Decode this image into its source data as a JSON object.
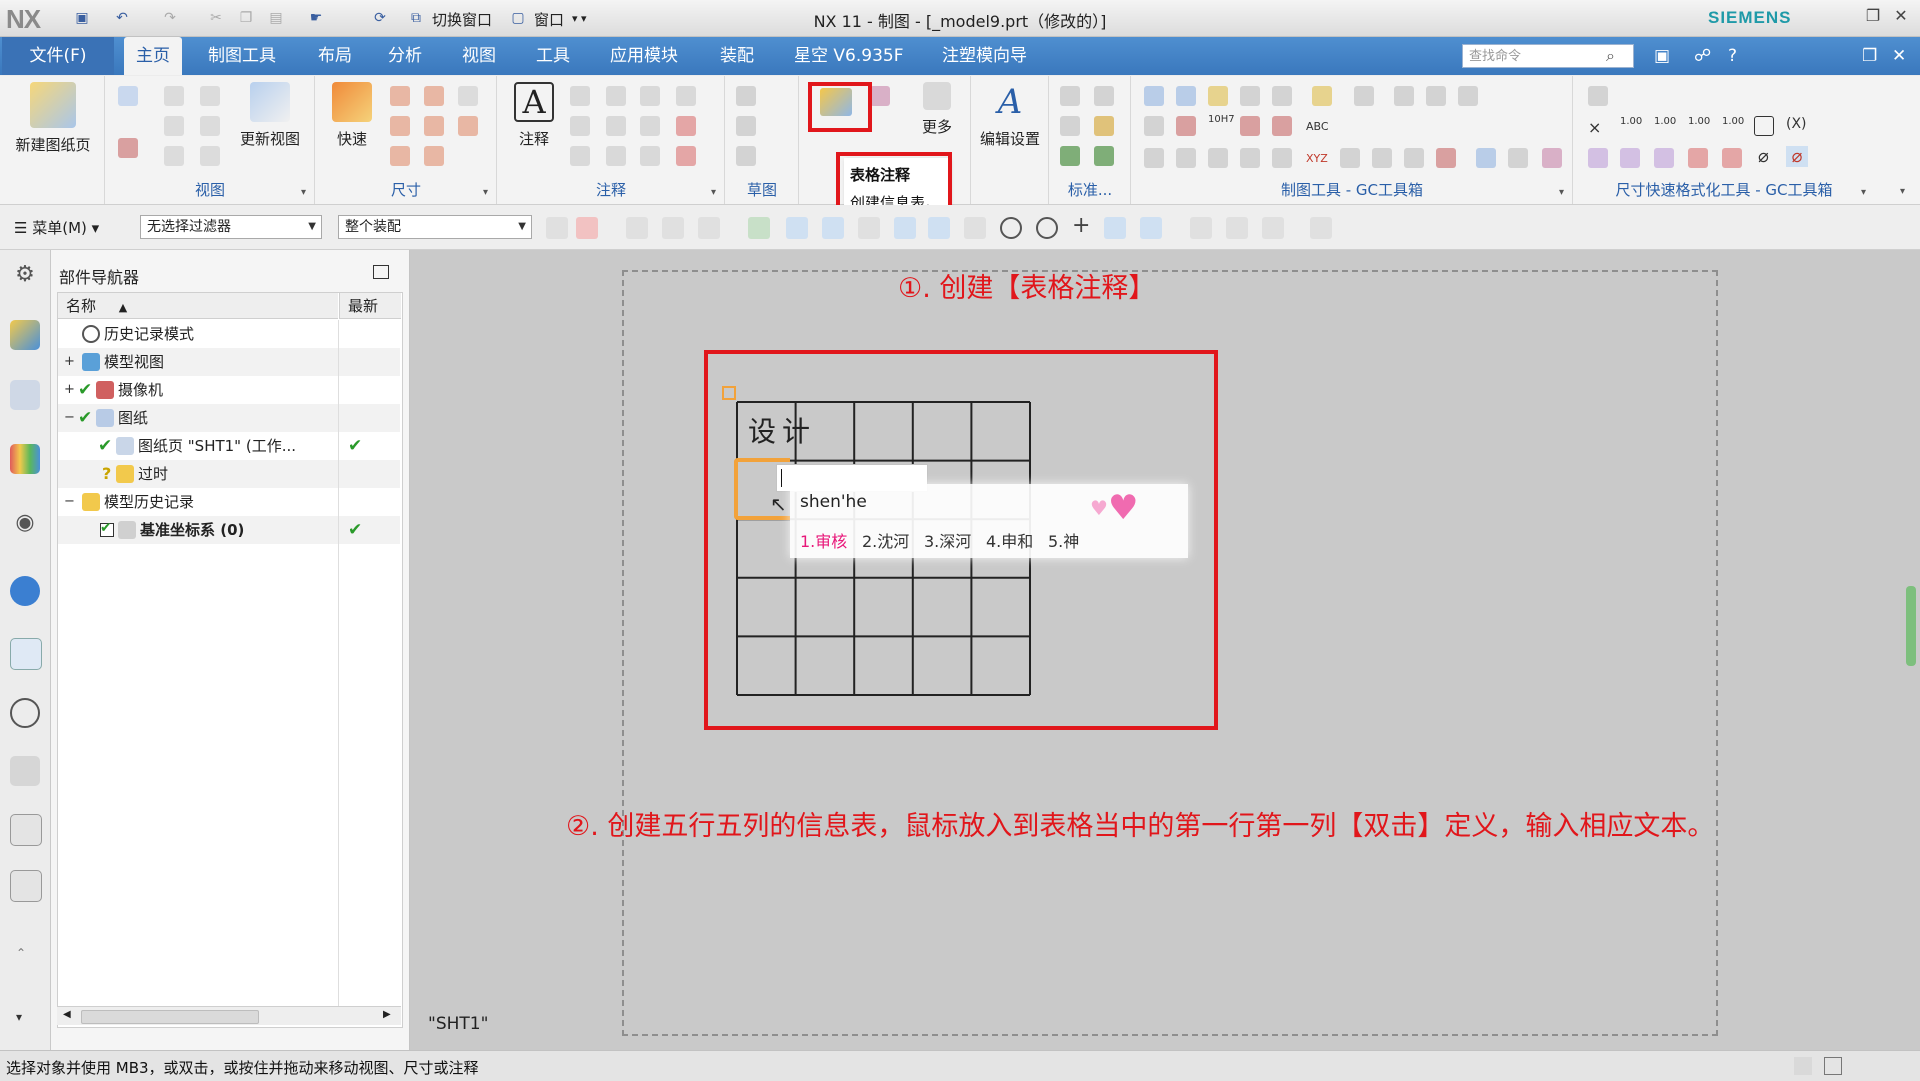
{
  "app": {
    "logo": "NX",
    "window_title": "NX 11 - 制图 - [_model9.prt（修改的）]",
    "brand": "SIEMENS",
    "quick_access": {
      "switch_window": "切换窗口",
      "window_menu": "窗口"
    }
  },
  "tabs": [
    {
      "label": "文件(F)"
    },
    {
      "label": "主页"
    },
    {
      "label": "制图工具"
    },
    {
      "label": "布局"
    },
    {
      "label": "分析"
    },
    {
      "label": "视图"
    },
    {
      "label": "工具"
    },
    {
      "label": "应用模块"
    },
    {
      "label": "装配"
    },
    {
      "label": "星空 V6.935F"
    },
    {
      "label": "注塑模向导"
    }
  ],
  "search": {
    "placeholder": "查找命令"
  },
  "ribbon": {
    "new_sheet": "新建图纸页",
    "update_view": "更新视图",
    "quick": "快速",
    "note": "注释",
    "more": "更多",
    "edit_settings": "编辑设置",
    "groups": {
      "view": "视图",
      "dimension": "尺寸",
      "annotation": "注释",
      "sketch": "草图",
      "standard": "标准...",
      "gc_toolbox": "制图工具 - GC工具箱",
      "dim_format": "尺寸快速格式化工具 - GC工具箱"
    },
    "small_labels": {
      "v1": "1.00",
      "v2": "1.00",
      "v3": "1.00",
      "v4": "1.00",
      "abc": "ABC",
      "xyz": "XYZ",
      "h7": "10H7"
    }
  },
  "popup_menu": {
    "items": [
      "表格注释",
      "创建信息表。"
    ]
  },
  "toolbar2": {
    "menu": "菜单(M)",
    "filter": "无选择过滤器",
    "scope": "整个装配"
  },
  "navigator": {
    "title": "部件导航器",
    "col_name": "名称",
    "col_latest": "最新",
    "rows": [
      {
        "label": "历史记录模式"
      },
      {
        "label": "模型视图"
      },
      {
        "label": "摄像机"
      },
      {
        "label": "图纸"
      },
      {
        "label": "图纸页 \"SHT1\" (工作..."
      },
      {
        "label": "过时"
      },
      {
        "label": "模型历史记录"
      },
      {
        "label": "基准坐标系 (0)"
      }
    ]
  },
  "canvas": {
    "sheet_name": "\"SHT1\"",
    "annotation1": "①. 创建【表格注释】",
    "annotation2": "②. 创建五行五列的信息表，鼠标放入到表格当中的第一行第一列【双击】定义，输入相应文本。",
    "table": {
      "rows": 5,
      "cols": 5,
      "cell_text": "设计"
    },
    "ime": {
      "input": "shen'he",
      "candidates": [
        "1.审核",
        "2.沈河",
        "3.深河",
        "4.申和",
        "5.神"
      ]
    }
  },
  "status": {
    "text": "选择对象并使用 MB3，或双击，或按住并拖动来移动视图、尺寸或注释"
  },
  "colors": {
    "accent": "#3a78bd",
    "annotation_red": "#e1161b",
    "selection_orange": "#f2a23a",
    "ime_pink": "#e8187a"
  }
}
